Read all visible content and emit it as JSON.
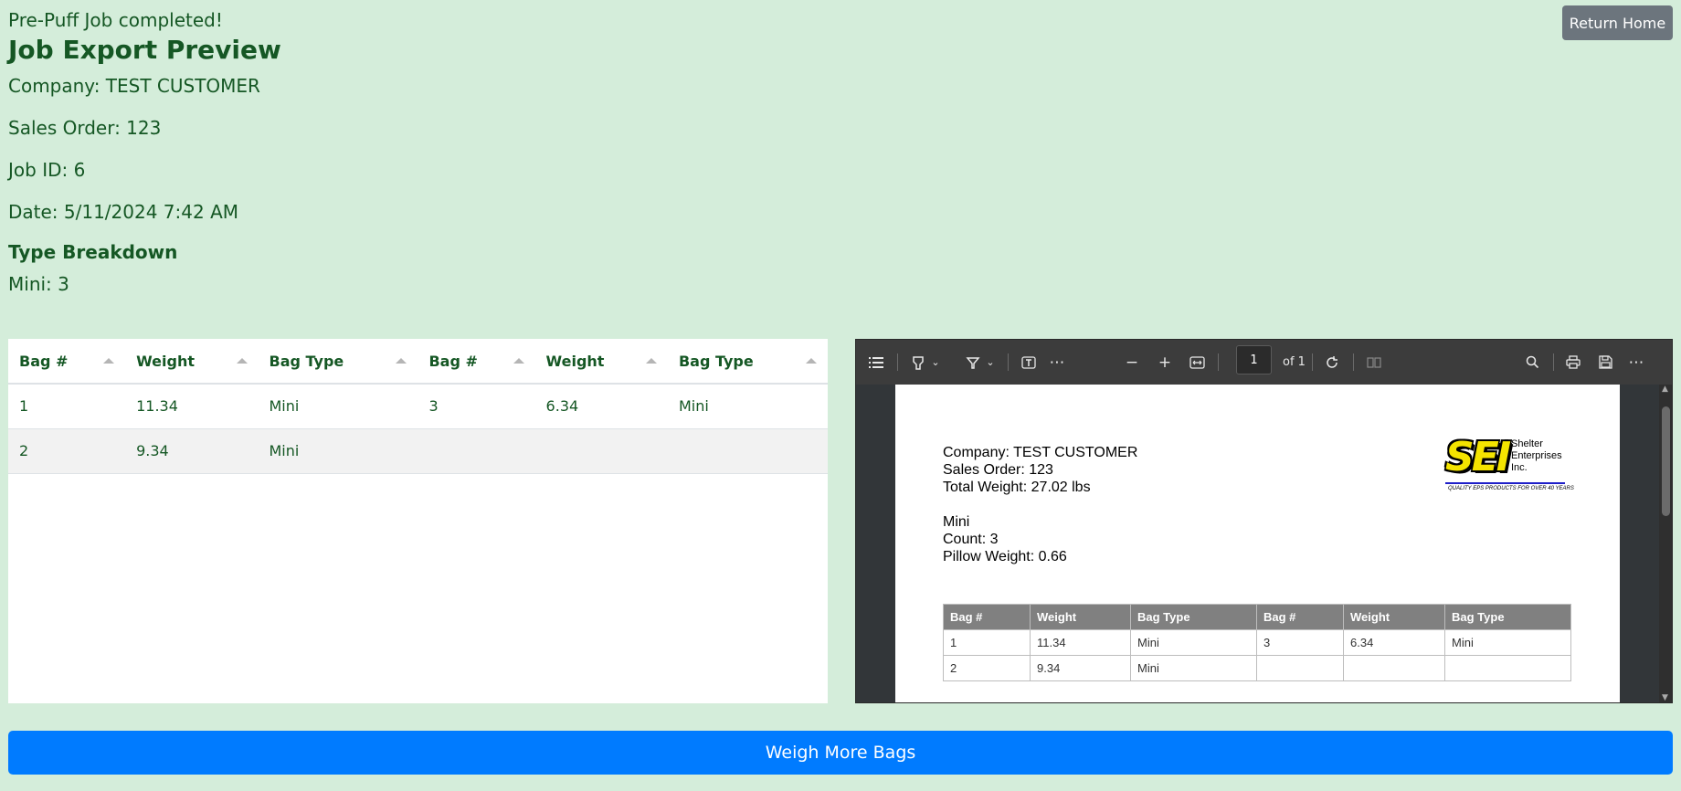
{
  "status": "Pre-Puff Job completed!",
  "title": "Job Export Preview",
  "header": {
    "return_home_label": "Return Home"
  },
  "info": {
    "company": "Company: TEST CUSTOMER",
    "sales_order": "Sales Order: 123",
    "job_id": "Job ID: 6",
    "date": "Date: 5/11/2024 7:42 AM"
  },
  "breakdown": {
    "heading": "Type Breakdown",
    "items": [
      "Mini: 3"
    ]
  },
  "table": {
    "columns": [
      "Bag #",
      "Weight",
      "Bag Type",
      "Bag #",
      "Weight",
      "Bag Type"
    ],
    "rows": [
      [
        "1",
        "11.34",
        "Mini",
        "3",
        "6.34",
        "Mini"
      ],
      [
        "2",
        "9.34",
        "Mini",
        "",
        "",
        ""
      ]
    ]
  },
  "pdf": {
    "page_value": "1",
    "page_of": "of 1",
    "lines": {
      "company": "Company: TEST CUSTOMER",
      "sales_order": "Sales Order: 123",
      "total_weight": "Total Weight: 27.02 lbs",
      "type": "Mini",
      "count": "Count: 3",
      "pillow_weight": "Pillow Weight: 0.66"
    },
    "logo": {
      "mark": "SEI",
      "company_line1": "Shelter",
      "company_line2": "Enterprises",
      "company_line3": "Inc.",
      "tagline": "QUALITY EPS PRODUCTS FOR OVER 40 YEARS",
      "bar_color": "#1e1ec8",
      "mark_color": "#f4e400"
    },
    "table": {
      "columns": [
        "Bag #",
        "Weight",
        "Bag Type",
        "Bag #",
        "Weight",
        "Bag Type"
      ],
      "rows": [
        [
          "1",
          "11.34",
          "Mini",
          "3",
          "6.34",
          "Mini"
        ],
        [
          "2",
          "9.34",
          "Mini",
          "",
          "",
          ""
        ]
      ]
    }
  },
  "actions": {
    "weigh_more_label": "Weigh More Bags"
  },
  "colors": {
    "page_bg": "#d4edda",
    "text": "#155724",
    "primary": "#007bff",
    "secondary": "#6c757d"
  }
}
